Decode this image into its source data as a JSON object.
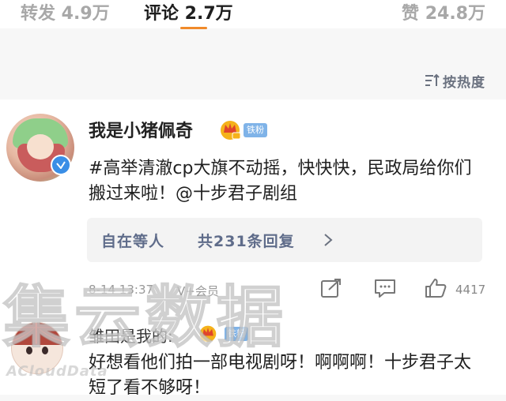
{
  "tabs": {
    "repost": "转发 4.9万",
    "comments": "评论 2.7万",
    "likes": "赞 24.8万",
    "active": "comments",
    "accent": "#f08a2a"
  },
  "sort": {
    "label": "按热度",
    "icon": "sort-icon"
  },
  "comments": [
    {
      "username": "我是小猪佩奇",
      "badge_icon": "crown-vip-icon",
      "fan_badge": "铁粉",
      "verified": true,
      "text": "#高举清澈cp大旗不动摇，快快快，民政局给你们搬过来啦！@十步君子剧组",
      "replies": {
        "first_replier": "自在等人",
        "count_text": "共231条回复"
      },
      "date": "8-14 13:37",
      "vip": "V+会员",
      "like_count": "4417"
    },
    {
      "username": "雏田是我的:",
      "badge_icon": "crown-vip-icon",
      "fan_badge": "铁粉",
      "text": "好想看他们拍一部电视剧呀！啊啊啊！十步君子太短了看不够呀！"
    }
  ],
  "watermark": {
    "main": "集云数据",
    "sub": "ACloudData"
  },
  "colors": {
    "link": "#5f6c8a",
    "badge": "#7fb3e8",
    "verified": "#3a8ee6"
  }
}
